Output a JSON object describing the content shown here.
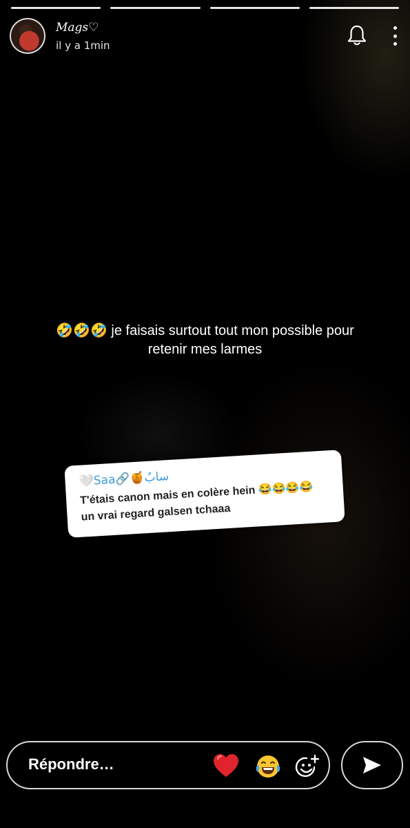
{
  "story": {
    "segments": 4,
    "user_name": "Mags♡",
    "timestamp": "il y a 1min",
    "caption_line1": "🤣🤣🤣 je faisais surtout tout mon possible pour",
    "caption_line2": "retenir mes larmes"
  },
  "reply_card": {
    "author": "🤍Saa🔗🍯سابُ",
    "text_line1": "T'étais canon mais en colère hein 😂😂😂😂",
    "text_line2": "un vrai regard galsen tchaaa"
  },
  "footer": {
    "reply_placeholder": "Répondre…",
    "quick_reactions": [
      "heart",
      "face-with-tears-of-joy"
    ],
    "icons": [
      "heart-icon",
      "laugh-icon",
      "emoji-add-icon",
      "send-icon",
      "bell-icon",
      "more-icon"
    ]
  },
  "colors": {
    "background": "#000000",
    "reply_author": "#3a9ad9",
    "heart": "#e0242e",
    "laugh": "#f8c630"
  }
}
